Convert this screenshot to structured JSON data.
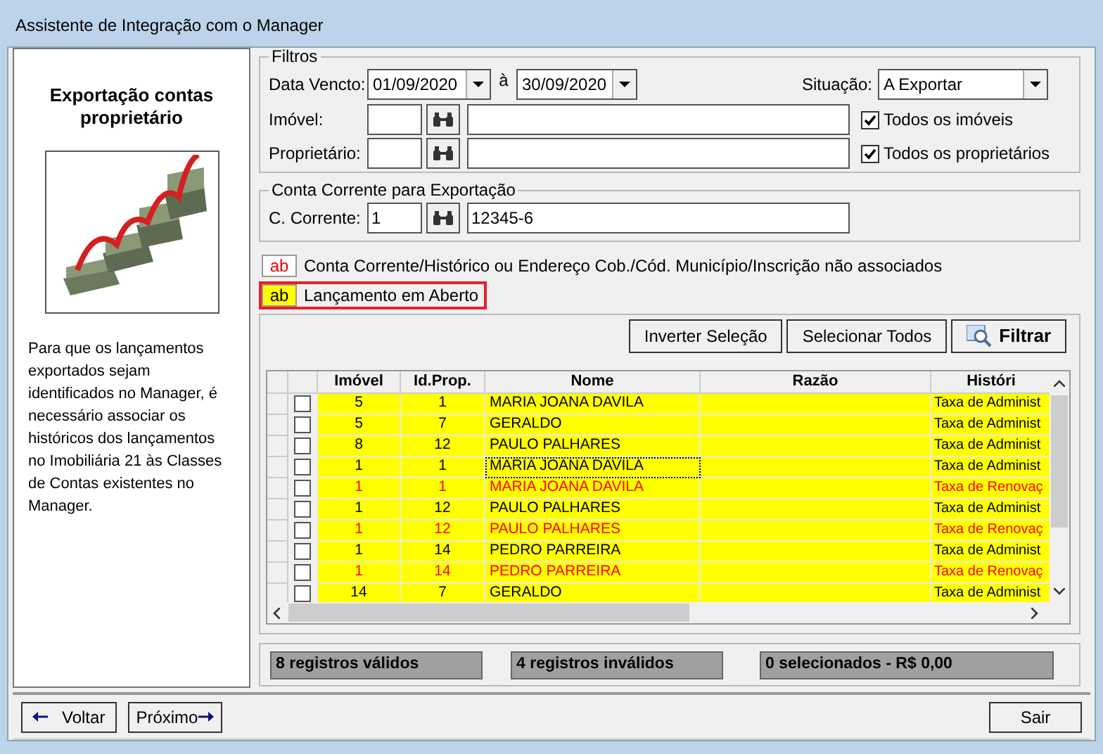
{
  "window": {
    "title": "Assistente de Integração com o Manager"
  },
  "sidebar": {
    "heading": "Exportação contas proprietário",
    "description": "Para que os lançamentos exportados sejam identificados no Manager, é necessário associar os históricos dos lançamentos no Imobiliária 21 às Classes de Contas existentes no Manager."
  },
  "filters": {
    "title": "Filtros",
    "date_label": "Data Vencto:",
    "date_from": "01/09/2020",
    "date_sep": "à",
    "date_to": "30/09/2020",
    "status_label": "Situação:",
    "status_value": "A Exportar",
    "property_label": "Imóvel:",
    "all_properties": {
      "label": "Todos os imóveis",
      "checked": true
    },
    "owner_label": "Proprietário:",
    "all_owners": {
      "label": "Todos os proprietários",
      "checked": true
    }
  },
  "account": {
    "title": "Conta Corrente para Exportação",
    "label": "C. Corrente:",
    "code": "1",
    "number": "12345-6"
  },
  "legend": [
    {
      "swatch": "ab",
      "label": "Conta Corrente/Histórico ou Endereço Cob./Cód. Município/Inscrição não associados",
      "kind": "error",
      "highlighted": false
    },
    {
      "swatch": "ab",
      "label": "Lançamento em Aberto",
      "kind": "open",
      "highlighted": true
    }
  ],
  "actions": [
    "Inverter Seleção",
    "Selecionar Todos",
    "Filtrar"
  ],
  "table": {
    "columns": [
      "Imóvel",
      "Id.Prop.",
      "Nome",
      "Razão",
      "Históri"
    ],
    "rows": [
      {
        "checked": false,
        "error": false,
        "focused": false,
        "cells": [
          "5",
          "1",
          "MARIA JOANA DAVILA",
          "",
          "Taxa de Administ"
        ]
      },
      {
        "checked": false,
        "error": false,
        "focused": false,
        "cells": [
          "5",
          "7",
          "GERALDO",
          "",
          "Taxa de Administ"
        ]
      },
      {
        "checked": false,
        "error": false,
        "focused": false,
        "cells": [
          "8",
          "12",
          "PAULO PALHARES",
          "",
          "Taxa de Administ"
        ]
      },
      {
        "checked": false,
        "error": false,
        "focused": true,
        "cells": [
          "1",
          "1",
          "MARIA JOANA DAVILA",
          "",
          "Taxa de Administ"
        ]
      },
      {
        "checked": false,
        "error": true,
        "focused": false,
        "cells": [
          "1",
          "1",
          "MARIA JOANA DAVILA",
          "",
          "Taxa de Renovaç"
        ]
      },
      {
        "checked": false,
        "error": false,
        "focused": false,
        "cells": [
          "1",
          "12",
          "PAULO PALHARES",
          "",
          "Taxa de Administ"
        ]
      },
      {
        "checked": false,
        "error": true,
        "focused": false,
        "cells": [
          "1",
          "12",
          "PAULO PALHARES",
          "",
          "Taxa de Renovaç"
        ]
      },
      {
        "checked": false,
        "error": false,
        "focused": false,
        "cells": [
          "1",
          "14",
          "PEDRO PARREIRA",
          "",
          "Taxa de Administ"
        ]
      },
      {
        "checked": false,
        "error": true,
        "focused": false,
        "cells": [
          "1",
          "14",
          "PEDRO PARREIRA",
          "",
          "Taxa de Renovaç"
        ]
      },
      {
        "checked": false,
        "error": false,
        "focused": false,
        "cells": [
          "14",
          "7",
          "GERALDO",
          "",
          "Taxa de Administ"
        ]
      }
    ]
  },
  "summary": [
    "8 registros válidos",
    "4 registros inválidos",
    "0 selecionados - R$ 0,00"
  ],
  "footer": {
    "back": "Voltar",
    "next": "Próximo",
    "exit": "Sair"
  }
}
